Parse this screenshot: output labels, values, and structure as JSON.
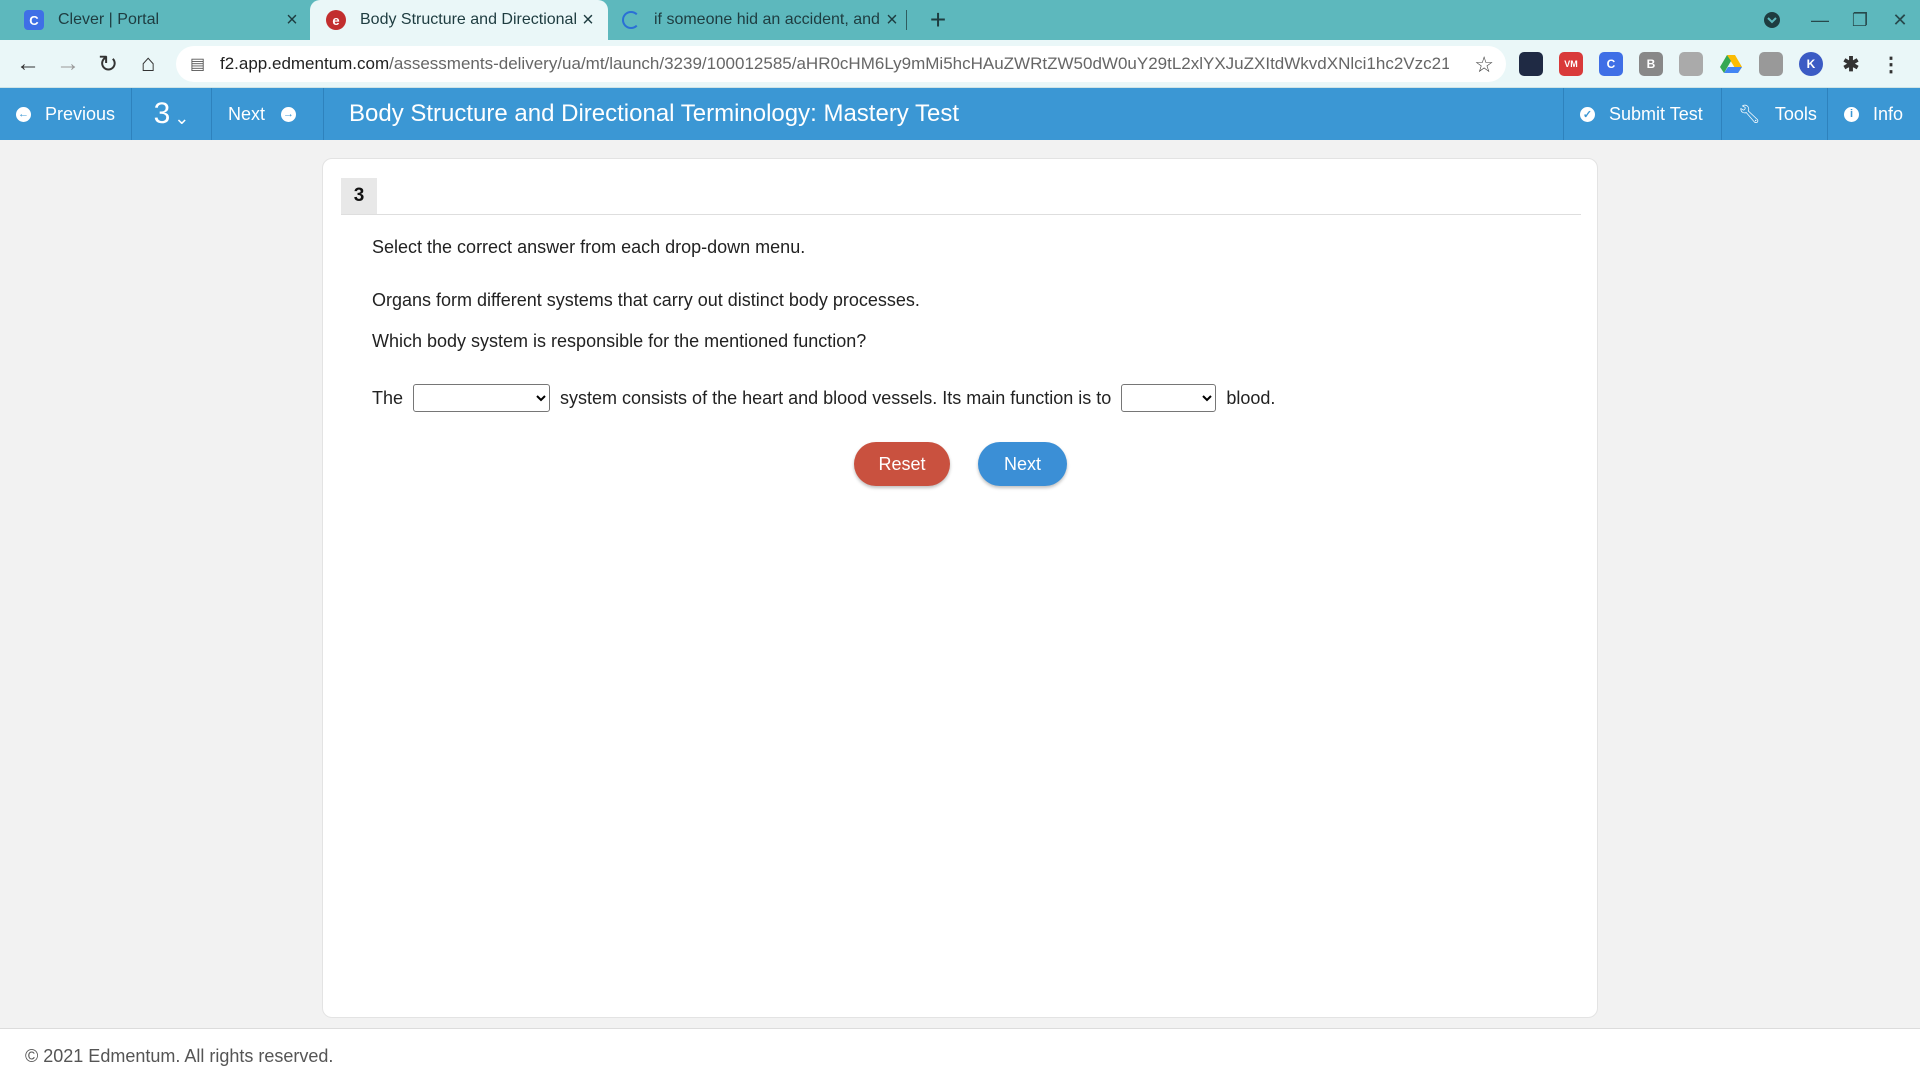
{
  "browser": {
    "tabs": [
      {
        "title": "Clever | Portal",
        "favicon": "C",
        "favicon_color": "#3f6fe6"
      },
      {
        "title": "Body Structure and Directional Terminology: Mastery Test",
        "favicon": "e",
        "favicon_color": "#c22e2e"
      },
      {
        "title": "if someone hid an accident, and ...",
        "favicon": "loading-spinner"
      }
    ],
    "url_host": "f2.app.edmentum.com",
    "url_path": "/assessments-delivery/ua/mt/launch/3239/100012585/aHR0cHM6Ly9mMi5hcHAuZWRtZW50dW0uY29tL2xlYXJuZXItdWkvdXNlci1hc2Vzc21lbnQ...",
    "extensions": [
      {
        "label": "",
        "color": "#1f2a44"
      },
      {
        "label": "VM",
        "color": "#d93a3a"
      },
      {
        "label": "C",
        "color": "#3f6fe6"
      },
      {
        "label": "B",
        "color": "#888888"
      },
      {
        "label": "",
        "color": "#aaaaaa"
      },
      {
        "label": "",
        "color": "#34a853"
      },
      {
        "label": "",
        "color": "#999999"
      },
      {
        "label": "K",
        "color": "#3b5bc4"
      }
    ]
  },
  "app": {
    "previous_label": "Previous",
    "question_number": "3",
    "next_label": "Next",
    "title": "Body Structure and Directional Terminology: Mastery Test",
    "submit_label": "Submit Test",
    "tools_label": "Tools",
    "info_label": "Info",
    "accent_color": "#3b97d4"
  },
  "question": {
    "number": "3",
    "instruction": "Select the correct answer from each drop-down menu.",
    "context": "Organs form different systems that carry out distinct body processes.",
    "prompt": "Which body system is responsible for the mentioned function?",
    "sentence_start": "The",
    "sentence_middle": "system consists of the heart and blood vessels. Its main function is to",
    "sentence_end": "blood.",
    "dropdown1_value": "",
    "dropdown2_value": ""
  },
  "buttons": {
    "reset_label": "Reset",
    "next_label": "Next",
    "reset_color": "#c9513f",
    "next_color": "#3b8fd6"
  },
  "footer": {
    "copyright": "© 2021 Edmentum. All rights reserved."
  }
}
